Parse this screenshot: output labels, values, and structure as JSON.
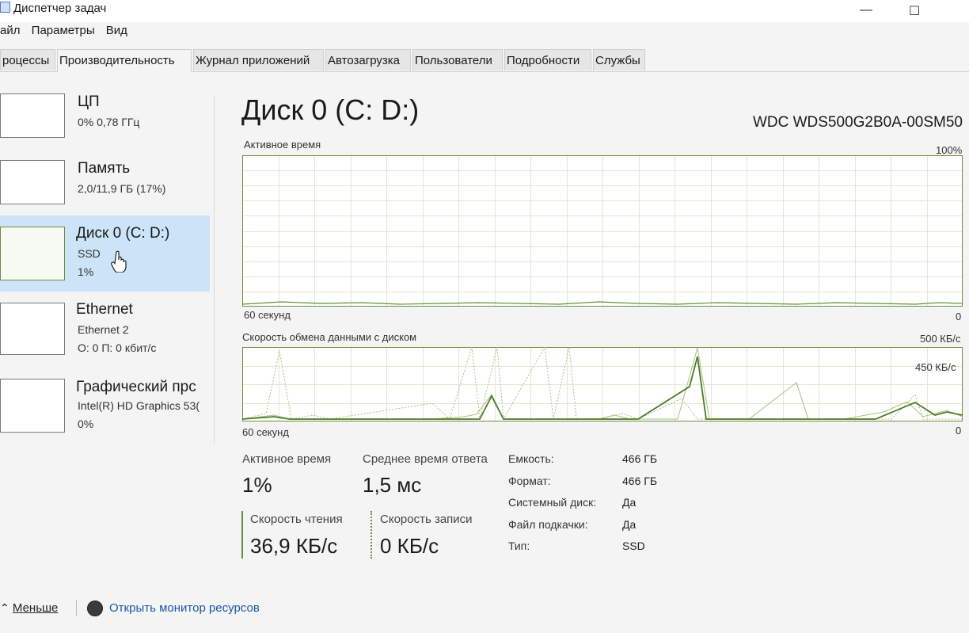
{
  "window": {
    "title": "Диспетчер задач",
    "minimize_icon": "minimize-icon",
    "maximize_icon": "maximize-icon"
  },
  "menu": [
    "айл",
    "Параметры",
    "Вид"
  ],
  "tabs": [
    "роцессы",
    "Производительность",
    "Журнал приложений",
    "Автозагрузка",
    "Пользователи",
    "Подробности",
    "Службы"
  ],
  "sidebar": {
    "items": [
      {
        "title": "ЦП",
        "sub1": "0% 0,78 ГГц"
      },
      {
        "title": "Память",
        "sub1": "2,0/11,9 ГБ (17%)"
      },
      {
        "title": "Диск 0 (C: D:)",
        "sub1": "SSD",
        "sub2": "1%"
      },
      {
        "title": "Ethernet",
        "sub1": "Ethernet 2",
        "sub2": "О: 0 П: 0 кбит/с"
      },
      {
        "title": "Графический прс",
        "sub1": "Intel(R) HD Graphics 53(",
        "sub2": "0%"
      }
    ]
  },
  "main": {
    "title": "Диск 0 (C: D:)",
    "model": "WDC  WDS500G2B0A-00SM50",
    "chart1": {
      "label": "Активное время",
      "max": "100%",
      "time": "60 секунд",
      "min": "0"
    },
    "chart2": {
      "label": "Скорость обмена данными с диском",
      "max": "500 КБ/с",
      "mid": "450 КБ/с",
      "time": "60 секунд",
      "min": "0"
    },
    "stats": {
      "active_label": "Активное время",
      "active_value": "1%",
      "response_label": "Среднее время ответа",
      "response_value": "1,5 мс",
      "read_label": "Скорость чтения",
      "read_value": "36,9 КБ/с",
      "write_label": "Скорость записи",
      "write_value": "0 КБ/с"
    },
    "props": [
      {
        "label": "Емкость:",
        "value": "466 ГБ"
      },
      {
        "label": "Формат:",
        "value": "466 ГБ"
      },
      {
        "label": "Системный диск:",
        "value": "Да"
      },
      {
        "label": "Файл подкачки:",
        "value": "Да"
      },
      {
        "label": "Тип:",
        "value": "SSD"
      }
    ]
  },
  "footer": {
    "fewer": "Меньше",
    "monitor": "Открыть монитор ресурсов"
  },
  "colors": {
    "accent": "#6b8d3f",
    "grid": "#dfe9d3",
    "selected": "#cce4f7",
    "link": "#1a5aa6"
  }
}
